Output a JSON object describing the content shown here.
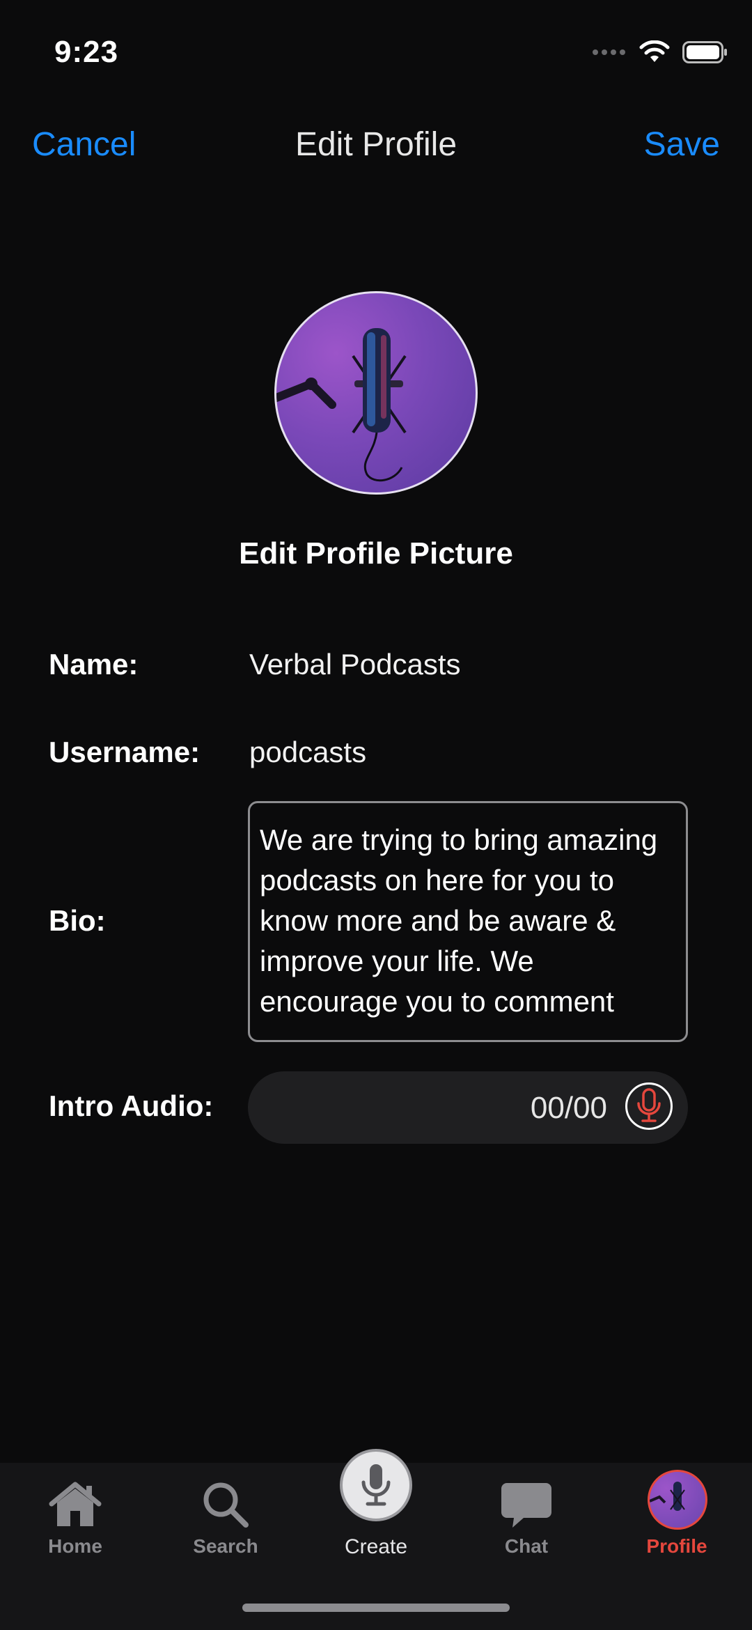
{
  "status_bar": {
    "time": "9:23",
    "icons": [
      "cellular-dots-icon",
      "wifi-icon",
      "battery-icon"
    ]
  },
  "nav": {
    "cancel": "Cancel",
    "title": "Edit Profile",
    "save": "Save",
    "accent_color": "#1a8cff"
  },
  "profile": {
    "edit_picture_label": "Edit Profile Picture",
    "name_label": "Name:",
    "name_value": "Verbal Podcasts",
    "username_label": "Username:",
    "username_value": "podcasts",
    "bio_label": "Bio:",
    "bio_value": "We are trying to bring amazing podcasts on here for you to know more and be aware & improve your life. We encourage you to comment",
    "intro_audio_label": "Intro Audio:",
    "intro_audio_time": "00/00"
  },
  "tab_bar": {
    "tabs": [
      {
        "label": "Home",
        "icon": "home-icon"
      },
      {
        "label": "Search",
        "icon": "search-icon"
      },
      {
        "label": "Create",
        "icon": "microphone-icon"
      },
      {
        "label": "Chat",
        "icon": "chat-bubble-icon"
      },
      {
        "label": "Profile",
        "icon": "profile-avatar-icon"
      }
    ],
    "active_tab": "Profile",
    "active_color": "#e5473d"
  }
}
